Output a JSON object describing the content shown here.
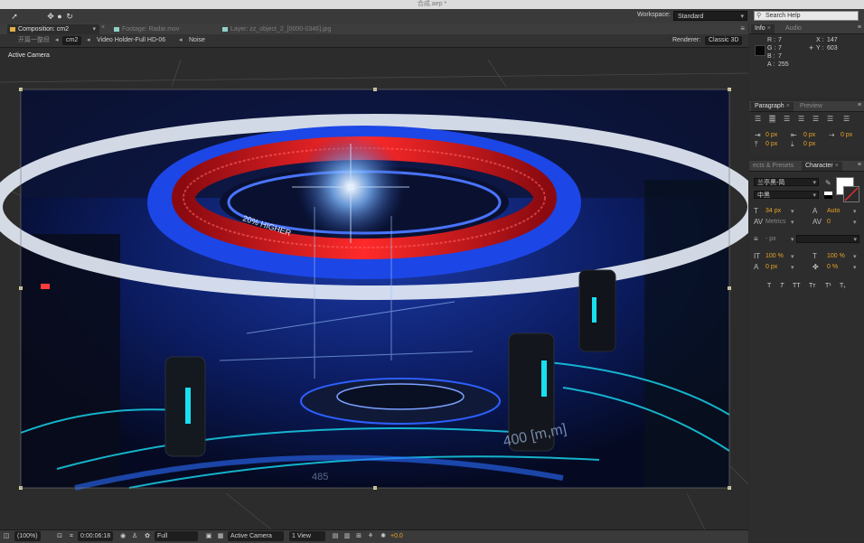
{
  "window": {
    "title": "合成.aep *"
  },
  "toolbar": {
    "workspace_label": "Workspace:",
    "workspace_value": "Standard",
    "search_placeholder": "Search Help"
  },
  "comp_panel": {
    "tabs": [
      {
        "label": "Composition: cm2",
        "active": true
      },
      {
        "label": "Footage: Radar.mov",
        "active": false
      },
      {
        "label": "Layer: zz_object_2_[0000-0346].jpg",
        "active": false
      }
    ],
    "breadcrumbs": [
      "开篇一整段",
      "cm2",
      "Video Holder-Full HD-06",
      "Noise"
    ],
    "renderer_label": "Renderer:",
    "renderer_value": "Classic 3D",
    "view_label": "Active Camera",
    "viewer_overlay_texts": [
      "20% HIGHER",
      "400 [m,m]",
      "485"
    ]
  },
  "bottom_bar": {
    "zoom": "(100%)",
    "timecode": "0:00:06:18",
    "resolution": "Full",
    "camera": "Active Camera",
    "views": "1 View",
    "exposure": "+0.0"
  },
  "info_panel": {
    "tabs": [
      "Info",
      "Audio"
    ],
    "r_label": "R :",
    "r_value": "7",
    "g_label": "G :",
    "g_value": "7",
    "b_label": "B :",
    "b_value": "7",
    "a_label": "A :",
    "a_value": "255",
    "x_label": "X :",
    "x_value": "147",
    "y_label": "Y :",
    "y_value": "603"
  },
  "paragraph_panel": {
    "tabs": [
      "Paragraph",
      "Preview"
    ],
    "indents": [
      "0 px",
      "0 px",
      "0 px",
      "0 px",
      "0 px"
    ]
  },
  "character_panel": {
    "tabs": [
      "ects & Presets",
      "Character"
    ],
    "font_family": "兰亭黑-简",
    "font_style": "中黑",
    "font_size": "34 px",
    "leading": "Auto",
    "kerning": "Metrics",
    "tracking": "0",
    "stroke_width": "- px",
    "vertical_scale": "100 %",
    "horizontal_scale": "100 %",
    "baseline_shift": "0 px",
    "tsume": "0 %",
    "format_buttons": [
      "T",
      "T",
      "TT",
      "Tт",
      "T¹",
      "T₁"
    ]
  },
  "colors": {
    "accent_orange": "#e7a326",
    "panel_bg": "#2d2d2d",
    "viewer_red": "#d51d1d",
    "viewer_blue": "#1740c8",
    "viewer_cyan": "#18d0e8"
  }
}
